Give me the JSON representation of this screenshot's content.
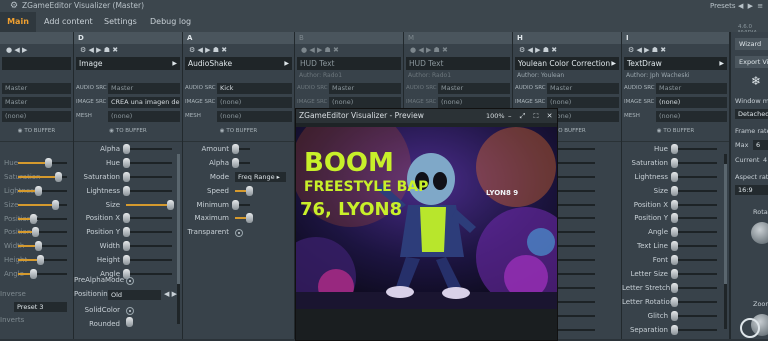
{
  "window": {
    "title": "ZGameEditor Visualizer  (Master)",
    "presets_label": "Presets",
    "version": "4.6.0 NVIDIA"
  },
  "menu": {
    "tabs": [
      {
        "label": "Main"
      },
      {
        "label": "Add content"
      },
      {
        "label": "Settings"
      },
      {
        "label": "Debug log"
      }
    ]
  },
  "col1": {
    "slider_labels": [
      "Hue",
      "Saturation",
      "Lightness",
      "Size",
      "Position X",
      "Position Y",
      "Width",
      "Height",
      "Angle"
    ],
    "slider_values": [
      0.62,
      0.82,
      0.4,
      0.75,
      0.3,
      0.35,
      0.4,
      0.45,
      0.3
    ],
    "combo_value": "Preset 3",
    "extra_labels": [
      "Inverse",
      "Inverts"
    ]
  },
  "col2": {
    "letter": "D",
    "name": "Image",
    "audio_src_label": "AUDIO SRC",
    "audio_src": "Master",
    "image_src_label": "IMAGE SRC",
    "image_src": "CREA una imagen de...",
    "mesh_label": "MESH",
    "mesh": "(none)",
    "to_buffer": "TO BUFFER",
    "props": [
      {
        "label": "Alpha",
        "value": 0.0
      },
      {
        "label": "Hue",
        "value": 0.0
      },
      {
        "label": "Saturation",
        "value": 0.0
      },
      {
        "label": "Lightness",
        "value": 0.0
      },
      {
        "label": "Size",
        "value": 0.95
      },
      {
        "label": "Position X",
        "value": 0.0
      },
      {
        "label": "Position Y",
        "value": 0.0
      },
      {
        "label": "Width",
        "value": 0.0
      },
      {
        "label": "Height",
        "value": 0.0
      },
      {
        "label": "Angle",
        "value": 0.0
      }
    ],
    "pre_alpha_label": "PreAlphaMode",
    "positioning_label": "Positionin",
    "positioning_value": "Old",
    "solid_color_label": "SolidColor",
    "rounded_label": "Rounded"
  },
  "col3": {
    "letter": "A",
    "name": "AudioShake",
    "audio_src": "Kick",
    "image_src": "(none)",
    "mesh": "(none)",
    "to_buffer": "TO BUFFER",
    "props": [
      {
        "label": "Amount",
        "value": 0.0
      },
      {
        "label": "Alpha",
        "value": 0.0
      },
      {
        "label": "Mode",
        "value": null
      },
      {
        "label": "Speed",
        "value": 0.95
      },
      {
        "label": "Minimum",
        "value": 0.0
      },
      {
        "label": "Maximum",
        "value": 0.95
      },
      {
        "label": "Transparent",
        "value": null
      }
    ],
    "mode_value": "Freq Range"
  },
  "col4": {
    "letter": "B",
    "name": "HUD Text",
    "author": "Author: Rado1",
    "audio_src": "Master",
    "image_src": "(none)",
    "mesh": "(none)"
  },
  "col5": {
    "letter": "M",
    "name": "HUD Text",
    "author": "Author: Rado1",
    "audio_src": "Master",
    "image_src": "(none)",
    "mesh": "(none)"
  },
  "col6": {
    "letter": "H",
    "name": "Youlean Color Correction",
    "author": "Author: Youlean",
    "audio_src": "Master",
    "image_src": "(none)",
    "mesh": "(none)",
    "to_buffer": "TO BUFFER"
  },
  "col7": {
    "letter": "I",
    "name": "TextDraw",
    "author": "Author: Jph Wacheski",
    "audio_src": "Master",
    "image_src": "(none)",
    "mesh": "(none)",
    "to_buffer": "TO BUFFER",
    "props": [
      {
        "label": "Hue",
        "value": 0.0
      },
      {
        "label": "Saturation",
        "value": 0.0
      },
      {
        "label": "Lightness",
        "value": 0.0
      },
      {
        "label": "Size",
        "value": 0.0
      },
      {
        "label": "Position X",
        "value": 0.0
      },
      {
        "label": "Position Y",
        "value": 0.0
      },
      {
        "label": "Angle",
        "value": 0.0
      },
      {
        "label": "Text Line",
        "value": 0.0
      },
      {
        "label": "Font",
        "value": 0.0
      },
      {
        "label": "Letter Size",
        "value": 0.0
      },
      {
        "label": "Letter Stretch",
        "value": 0.0
      },
      {
        "label": "Letter Rotation",
        "value": 0.0
      },
      {
        "label": "Glitch",
        "value": 0.0
      },
      {
        "label": "Separation",
        "value": 0.0
      }
    ]
  },
  "side": {
    "wizard": "Wizard",
    "export": "Export Vi",
    "window_mode_label": "Window m",
    "window_mode": "Detached",
    "frame_rate_label": "Frame rate",
    "max_label": "Max",
    "max_value": "6",
    "current_label": "Current",
    "current_value": "4",
    "aspect_label": "Aspect rat",
    "aspect_value": "16:9",
    "rotate_label": "Rotat",
    "zoom_label": "Zoom"
  },
  "preview": {
    "title": "ZGameEditor Visualizer - Preview",
    "zoom": "100%",
    "art_text_1": "BOOM",
    "art_text_2": "FREESTYLE BAP",
    "art_text_3": "76, LYON8",
    "art_tag": "LYON8 9"
  }
}
